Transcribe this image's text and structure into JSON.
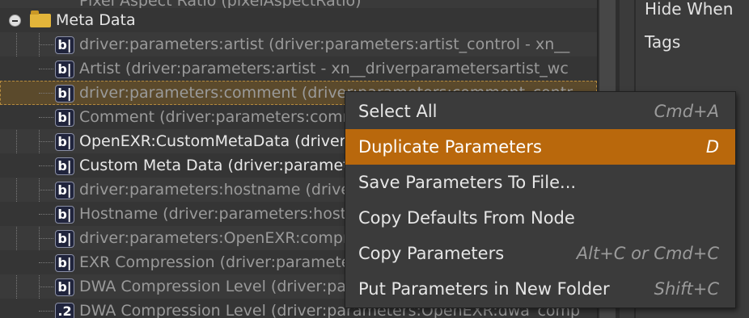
{
  "tree": {
    "rows": [
      {
        "text": "Pixel Aspect Ratio (pixelAspectRatio)",
        "badge": "",
        "kind": "dim"
      },
      {
        "text": "Meta Data",
        "badge": "folder",
        "kind": "folder"
      },
      {
        "text": "driver:parameters:artist (driver:parameters:artist_control - xn__",
        "badge": "b|",
        "kind": "dim"
      },
      {
        "text": "Artist (driver:parameters:artist - xn__driverparametersartist_wc",
        "badge": "b|",
        "kind": "dim"
      },
      {
        "text": "driver:parameters:comment (driver:parameters:comment_contr",
        "badge": "b|",
        "kind": "dim"
      },
      {
        "text": "Comment (driver:parameters:comment - xn__driverparameterscomm",
        "badge": "b|",
        "kind": "dim"
      },
      {
        "text": "OpenEXR:CustomMetaData (driver:parameters:OpenEXR:customMetaData",
        "badge": "b|",
        "kind": "bright"
      },
      {
        "text": "Custom Meta Data (driver:parameters:OpenEXR:customMetaData",
        "badge": "b|",
        "kind": "bright"
      },
      {
        "text": "driver:parameters:hostname (driver:parameters:hostname_control",
        "badge": "b|",
        "kind": "dim"
      },
      {
        "text": "Hostname (driver:parameters:hostname - xn__driverparametershost",
        "badge": "b|",
        "kind": "dim"
      },
      {
        "text": "driver:parameters:OpenEXR:compression (driver:parameters:Open",
        "badge": "b|",
        "kind": "dim"
      },
      {
        "text": "EXR Compression (driver:parameters:OpenEXR:compression",
        "badge": "b|",
        "kind": "dim"
      },
      {
        "text": "DWA Compression Level (driver:parameters:OpenEXR:dwa_comp",
        "badge": "b|",
        "kind": "dim"
      },
      {
        "text": "DWA Compression Level (driver:parameters:OpenEXR:dwa_comp",
        "badge": ".2",
        "kind": "dim"
      }
    ]
  },
  "right_panel": {
    "labels": [
      "Hide When",
      "Tags"
    ]
  },
  "context_menu": {
    "items": [
      {
        "label": "Select All",
        "shortcut": "Cmd+A"
      },
      {
        "label": "Duplicate Parameters",
        "shortcut": "D"
      },
      {
        "label": "Save Parameters To File...",
        "shortcut": ""
      },
      {
        "label": "Copy Defaults From Node",
        "shortcut": ""
      },
      {
        "label": "Copy Parameters",
        "shortcut": "Alt+C or Cmd+C"
      },
      {
        "label": "Put Parameters in New Folder",
        "shortcut": "Shift+C"
      }
    ],
    "highlighted_index": 1
  },
  "colors": {
    "menu_highlight": "#b9680c",
    "folder": "#e3b53a",
    "badge_bg": "#20243c"
  }
}
